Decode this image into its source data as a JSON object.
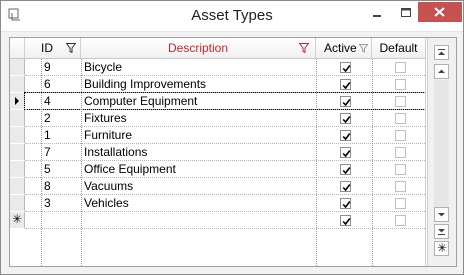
{
  "window": {
    "title": "Asset Types"
  },
  "columns": {
    "id": "ID",
    "description": "Description",
    "active": "Active",
    "default": "Default"
  },
  "rows": [
    {
      "id": "9",
      "description": "Bicycle",
      "active": true,
      "default": false
    },
    {
      "id": "6",
      "description": "Building Improvements",
      "active": true,
      "default": false
    },
    {
      "id": "4",
      "description": "Computer Equipment",
      "active": true,
      "default": false
    },
    {
      "id": "2",
      "description": "Fixtures",
      "active": true,
      "default": false
    },
    {
      "id": "1",
      "description": "Furniture",
      "active": true,
      "default": false
    },
    {
      "id": "7",
      "description": "Installations",
      "active": true,
      "default": false
    },
    {
      "id": "5",
      "description": "Office Equipment",
      "active": true,
      "default": false
    },
    {
      "id": "8",
      "description": "Vacuums",
      "active": true,
      "default": false
    },
    {
      "id": "3",
      "description": "Vehicles",
      "active": true,
      "default": false
    }
  ],
  "current_row_index": 2,
  "new_row": {
    "marker": "✳",
    "active": true,
    "default": false
  },
  "colors": {
    "description_header": "#c0282e",
    "filter_icon_active": "#c0282e",
    "close_button": "#c75050"
  }
}
